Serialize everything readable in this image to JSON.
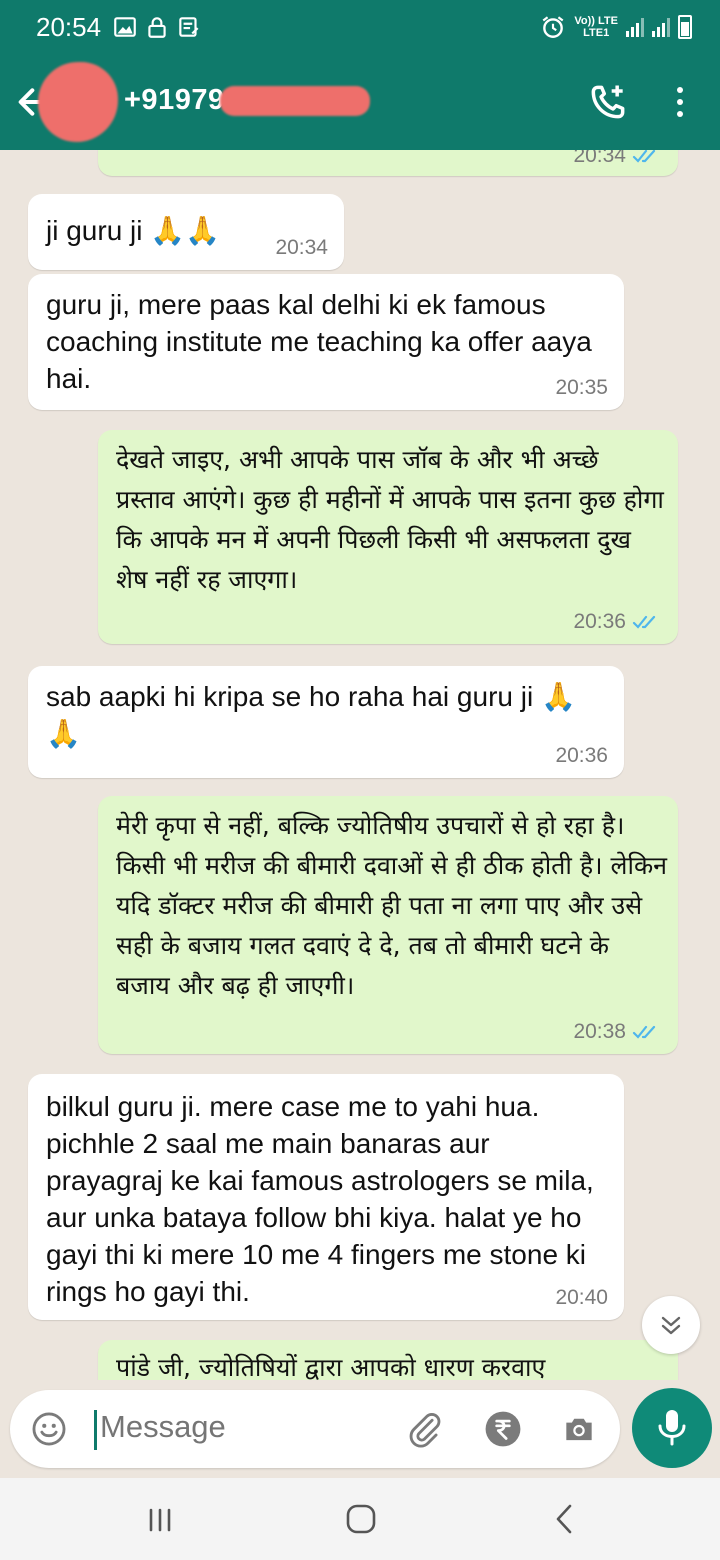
{
  "status_bar": {
    "time": "20:54",
    "network_top": "Vo)) LTE",
    "network_bottom": "LTE1"
  },
  "header": {
    "contact_name": "+91979",
    "back_icon": "arrow-left-icon",
    "call_icon": "add-call-icon",
    "menu_icon": "more-vert-icon"
  },
  "messages": [
    {
      "dir": "out",
      "text": "",
      "time": "20:34",
      "ticks": "read"
    },
    {
      "dir": "in",
      "text": "ji guru ji 🙏🙏",
      "time": "20:34"
    },
    {
      "dir": "in",
      "text": "guru ji, mere paas kal delhi ki ek famous coaching institute me teaching ka offer aaya hai.",
      "time": "20:35"
    },
    {
      "dir": "out",
      "text": "देखते जाइए, अभी आपके पास जॉब के और भी अच्छे प्रस्ताव आएंगे। कुछ ही महीनों में आपके पास इतना कुछ होगा कि आपके मन में अपनी पिछली किसी भी असफलता दुख शेष नहीं रह जाएगा।",
      "time": "20:36",
      "ticks": "read"
    },
    {
      "dir": "in",
      "text": "sab aapki hi kripa se ho raha hai guru ji 🙏🙏",
      "time": "20:36"
    },
    {
      "dir": "out",
      "text": "मेरी कृपा से नहीं, बल्कि ज्योतिषीय उपचारों से हो रहा है। किसी भी मरीज की बीमारी दवाओं से ही ठीक होती है। लेकिन यदि डॉक्टर मरीज की बीमारी ही पता ना लगा पाए और उसे सही के बजाय गलत दवाएं दे दे, तब तो बीमारी घटने के बजाय और बढ़ ही जाएगी।",
      "time": "20:38",
      "ticks": "read"
    },
    {
      "dir": "in",
      "text": "bilkul guru ji. mere case me to yahi hua. pichhle 2 saal me main banaras aur prayagraj ke kai famous astrologers se mila, aur unka bataya follow bhi kiya. halat ye ho gayi thi ki mere 10 me 4 fingers me stone ki rings ho gayi thi.",
      "time": "20:40"
    },
    {
      "dir": "out",
      "text": "पांडे जी, ज्योतिषियों द्वारा आपको धारण करवाए",
      "time": "",
      "ticks": ""
    }
  ],
  "input": {
    "placeholder": "Message",
    "emoji_icon": "emoji-icon",
    "attach_icon": "paperclip-icon",
    "payment_icon": "rupee-icon",
    "camera_icon": "camera-icon",
    "mic_icon": "mic-icon"
  },
  "colors": {
    "header_bg": "#0f7a6b",
    "chat_bg": "#ece5dd",
    "outgoing_bubble": "#e1f7cb",
    "incoming_bubble": "#ffffff",
    "read_ticks": "#4fb6ec",
    "mic_button": "#0f8a78"
  }
}
